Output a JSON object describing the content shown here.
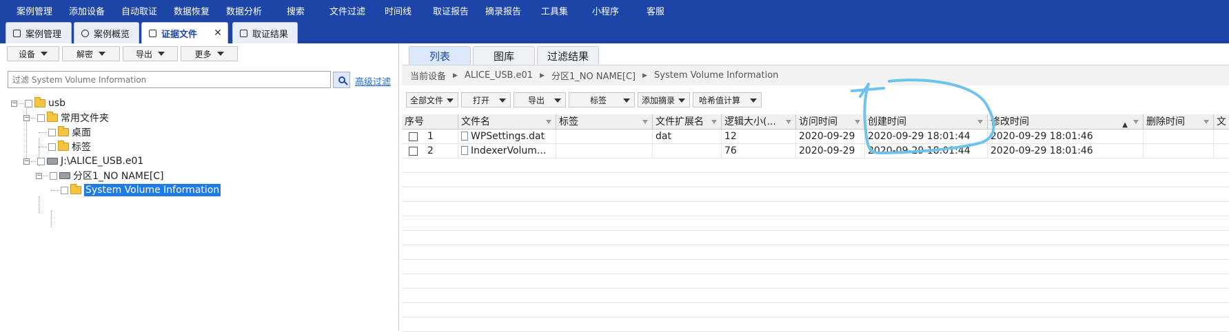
{
  "menu": [
    "案例管理",
    "添加设备",
    "自动取证",
    "数据恢复",
    "数据分析",
    "搜索",
    "文件过滤",
    "时间线",
    "取证报告",
    "摘录报告",
    "工具集",
    "小程序",
    "客服"
  ],
  "tabs": [
    {
      "label": "案例管理",
      "icon": "edit-icon"
    },
    {
      "label": "案例概览",
      "icon": "pie-chart-icon"
    },
    {
      "label": "证据文件",
      "icon": "copy-icon",
      "close": "✕"
    },
    {
      "label": "取证结果",
      "icon": "edit-icon"
    }
  ],
  "left": {
    "buttons": [
      "设备",
      "解密",
      "导出",
      "更多"
    ],
    "filter_placeholder": "过滤 System Volume Information",
    "advanced_filter": "高级过滤",
    "tree": {
      "usb": "usb",
      "common": "常用文件夹",
      "desktop": "桌面",
      "bookmark": "标签",
      "image": "J:\\ALICE_USB.e01",
      "partition": "分区1_NO NAME[C]",
      "selected": "System Volume Information"
    }
  },
  "right": {
    "view_tabs": [
      "列表",
      "图库",
      "过滤结果"
    ],
    "breadcrumb": [
      "当前设备",
      "ALICE_USB.e01",
      "分区1_NO NAME[C]",
      "System Volume Information"
    ],
    "toolbar": [
      "全部文件",
      "打开",
      "导出",
      "标签",
      "添加摘录",
      "哈希值计算"
    ],
    "columns": [
      "序号",
      "文件名",
      "标签",
      "文件扩展名",
      "逻辑大小(...",
      "访问时间",
      "创建时间",
      "修改时间",
      "删除时间",
      "文"
    ],
    "rows": [
      {
        "no": "1",
        "name": "WPSettings.dat",
        "tag": "",
        "ext": "dat",
        "size": "12",
        "access": "2020-09-29",
        "created": "2020-09-29 18:01:44",
        "modified": "2020-09-29 18:01:46",
        "deleted": ""
      },
      {
        "no": "2",
        "name": "IndexerVolum...",
        "tag": "",
        "ext": "",
        "size": "76",
        "access": "2020-09-29",
        "created": "2020-09-29 18:01:44",
        "modified": "2020-09-29 18:01:46",
        "deleted": ""
      }
    ]
  },
  "colors": {
    "brand": "#1d45a8",
    "selection": "#1d7be8",
    "annotation": "#6ec3ec"
  }
}
